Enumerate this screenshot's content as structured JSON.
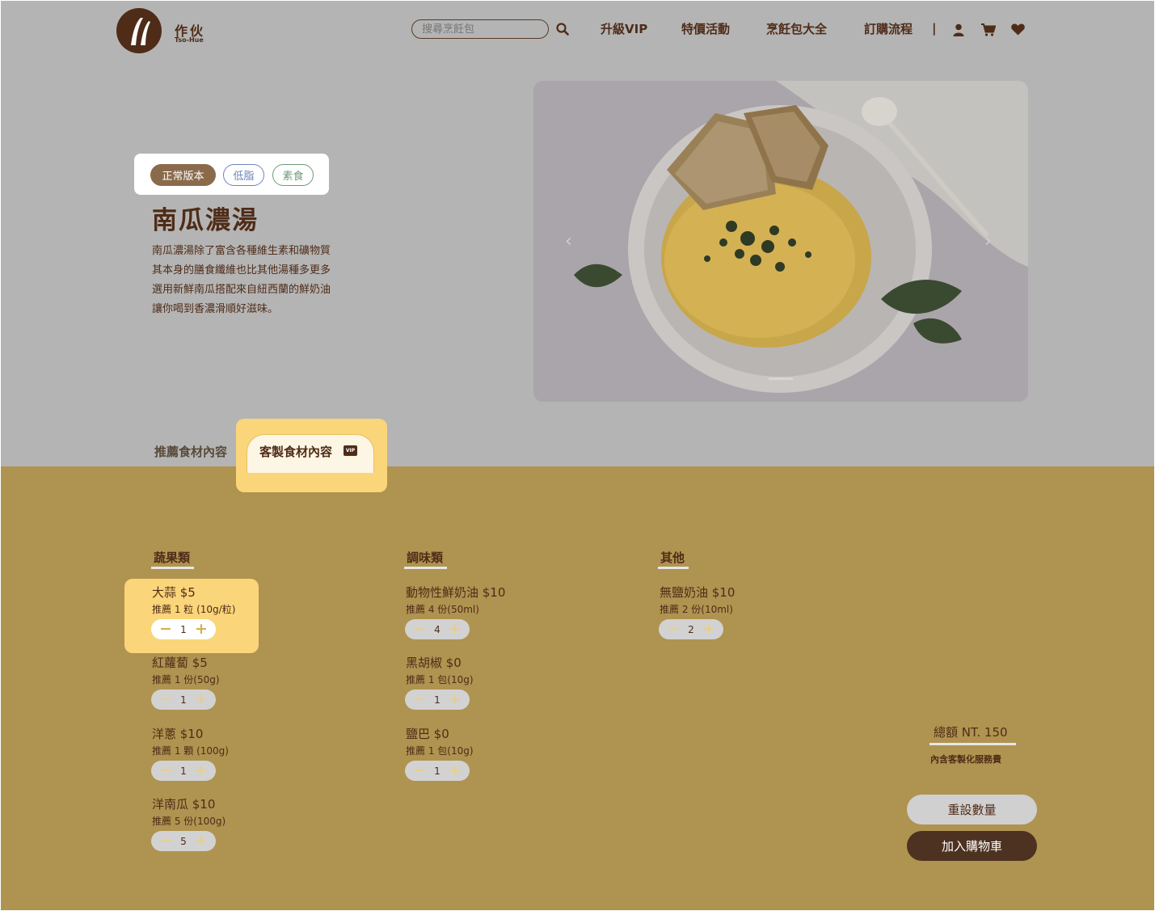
{
  "header": {
    "logo_name": "作伙",
    "logo_sub": "Tso-Hue",
    "search_placeholder": "搜尋烹飪包",
    "nav": [
      "升級VIP",
      "特價活動",
      "烹飪包大全",
      "訂購流程"
    ],
    "separator": "|",
    "icons": [
      "user-icon",
      "cart-icon",
      "heart-icon"
    ]
  },
  "hero": {
    "versions": [
      "正常版本",
      "低脂",
      "素食"
    ],
    "selected_version": "正常版本",
    "title": "南瓜濃湯",
    "description": [
      "南瓜濃湯除了富含各種維生素和礦物質",
      "其本身的膳食纖維也比其他湯種多更多",
      "選用新鮮南瓜搭配來自紐西蘭的鮮奶油",
      "讓你喝到香濃滑順好滋味。"
    ],
    "carousel": {
      "prev": "‹",
      "next": "›",
      "slides": 1,
      "current": 1
    }
  },
  "tabs": {
    "recommended": "推薦食材內容",
    "custom": "客製食材內容",
    "vip_badge": "VIP",
    "active": "custom"
  },
  "categories": [
    {
      "title": "蔬果類",
      "items": [
        {
          "name": "大蒜 $5",
          "rec": "推薦 1 粒 (10g/粒)",
          "qty": "1"
        },
        {
          "name": "紅蘿蔔 $5",
          "rec": "推薦 1 份(50g)",
          "qty": "1"
        },
        {
          "name": "洋蔥 $10",
          "rec": "推薦 1 顆 (100g)",
          "qty": "1"
        },
        {
          "name": "洋南瓜 $10",
          "rec": "推薦 5 份(100g)",
          "qty": "5"
        }
      ]
    },
    {
      "title": "調味類",
      "items": [
        {
          "name": "動物性鮮奶油 $10",
          "rec": "推薦 4 份(50ml)",
          "qty": "4"
        },
        {
          "name": "黑胡椒 $0",
          "rec": "推薦 1 包(10g)",
          "qty": "1"
        },
        {
          "name": "鹽巴 $0",
          "rec": "推薦 1 包(10g)",
          "qty": "1"
        }
      ]
    },
    {
      "title": "其他",
      "items": [
        {
          "name": "無鹽奶油 $10",
          "rec": "推薦 2 份(10ml)",
          "qty": "2"
        }
      ]
    }
  ],
  "stepper": {
    "minus": "−",
    "plus": "+"
  },
  "summary": {
    "total": "總額 NT. 150",
    "note": "內含客製化服務費",
    "reset": "重設數量",
    "add_to_cart": "加入購物車"
  },
  "colors": {
    "brand_brown": "#4f2c18",
    "highlight_yellow": "#fad57a",
    "panel_gold": "#af9350",
    "overlay_gray": "#b4b4b4"
  }
}
